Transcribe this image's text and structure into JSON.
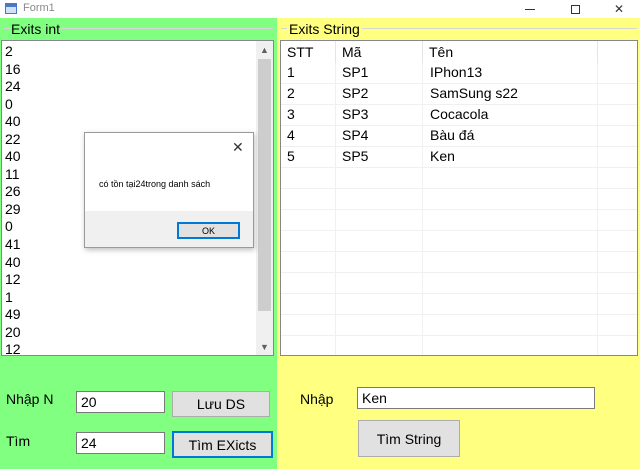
{
  "window": {
    "title": "Form1",
    "minimize_icon": "minimize-icon",
    "maximize_icon": "maximize-icon",
    "close_icon": "close-icon"
  },
  "int_panel": {
    "title": "Exits int",
    "color": "#80ff80",
    "list": [
      "2",
      "16",
      "24",
      "0",
      "40",
      "22",
      "40",
      "11",
      "26",
      "29",
      "0",
      "41",
      "40",
      "12",
      "1",
      "49",
      "20",
      "12"
    ],
    "label_n": "Nhập N",
    "input_n": "20",
    "save_button": "Lưu DS",
    "label_find": "Tìm",
    "input_find": "24",
    "find_button": "Tìm EXicts"
  },
  "string_panel": {
    "title": "Exits String",
    "color": "#ffff80",
    "columns": [
      "STT",
      "Mã",
      "Tên"
    ],
    "rows": [
      {
        "stt": "1",
        "ma": "SP1",
        "ten": "IPhon13"
      },
      {
        "stt": "2",
        "ma": "SP2",
        "ten": "SamSung s22"
      },
      {
        "stt": "3",
        "ma": "SP3",
        "ten": "Cocacola"
      },
      {
        "stt": "4",
        "ma": "SP4",
        "ten": "Bàu đá"
      },
      {
        "stt": "5",
        "ma": "SP5",
        "ten": "Ken"
      }
    ],
    "label_input": "Nhập",
    "input_value": "Ken",
    "find_button": "Tìm String"
  },
  "dialog": {
    "message": "có tồn tại24trong danh sách",
    "ok_button": "OK"
  }
}
